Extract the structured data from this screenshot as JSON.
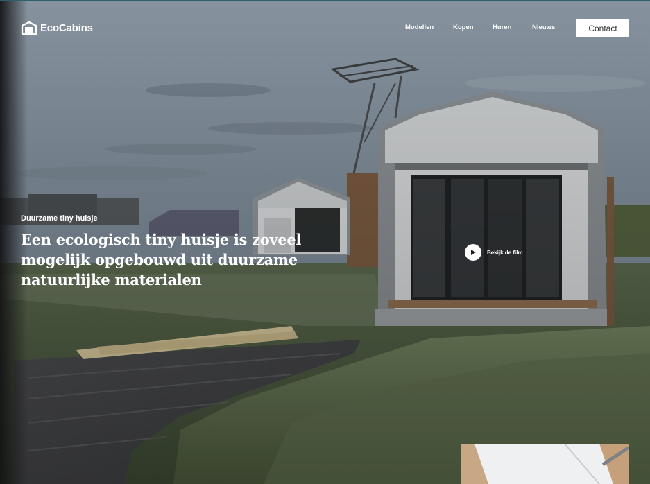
{
  "brand": {
    "name": "EcoCabins",
    "logo_icon": "house-logo-icon"
  },
  "nav": {
    "items": [
      {
        "label": "Modellen"
      },
      {
        "label": "Kopen"
      },
      {
        "label": "Huren"
      },
      {
        "label": "Nieuws"
      }
    ],
    "contact_label": "Contact"
  },
  "hero": {
    "eyebrow": "Duurzame tiny huisje",
    "headline": "Een ecologisch tiny huisje is zoveel mogelijk opgebouwd uit duurzame natuurlijke materialen",
    "film_label": "Bekijk de film",
    "play_icon": "play-icon"
  },
  "colors": {
    "accent_line": "#2f5f6a",
    "button_bg": "#ffffff",
    "text": "#ffffff"
  }
}
